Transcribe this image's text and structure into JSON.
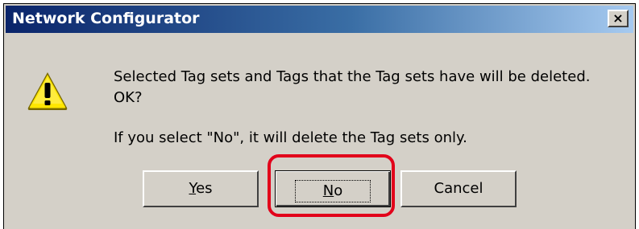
{
  "dialog": {
    "title": "Network Configurator",
    "close_glyph": "×",
    "icon": "warning-icon",
    "message_line1": "Selected Tag sets and Tags that the Tag sets have will be deleted.",
    "message_line2": "OK?",
    "message_line3": "If you select \"No\", it will delete the Tag sets only."
  },
  "buttons": {
    "yes": {
      "underlined": "Y",
      "rest": "es"
    },
    "no": {
      "underlined": "N",
      "rest": "o"
    },
    "cancel": {
      "label": "Cancel"
    }
  },
  "colors": {
    "title_bar_start": "#0a246a",
    "title_bar_end": "#a6caf0",
    "dialog_face": "#d4d0c8",
    "highlight": "#e2001a"
  }
}
